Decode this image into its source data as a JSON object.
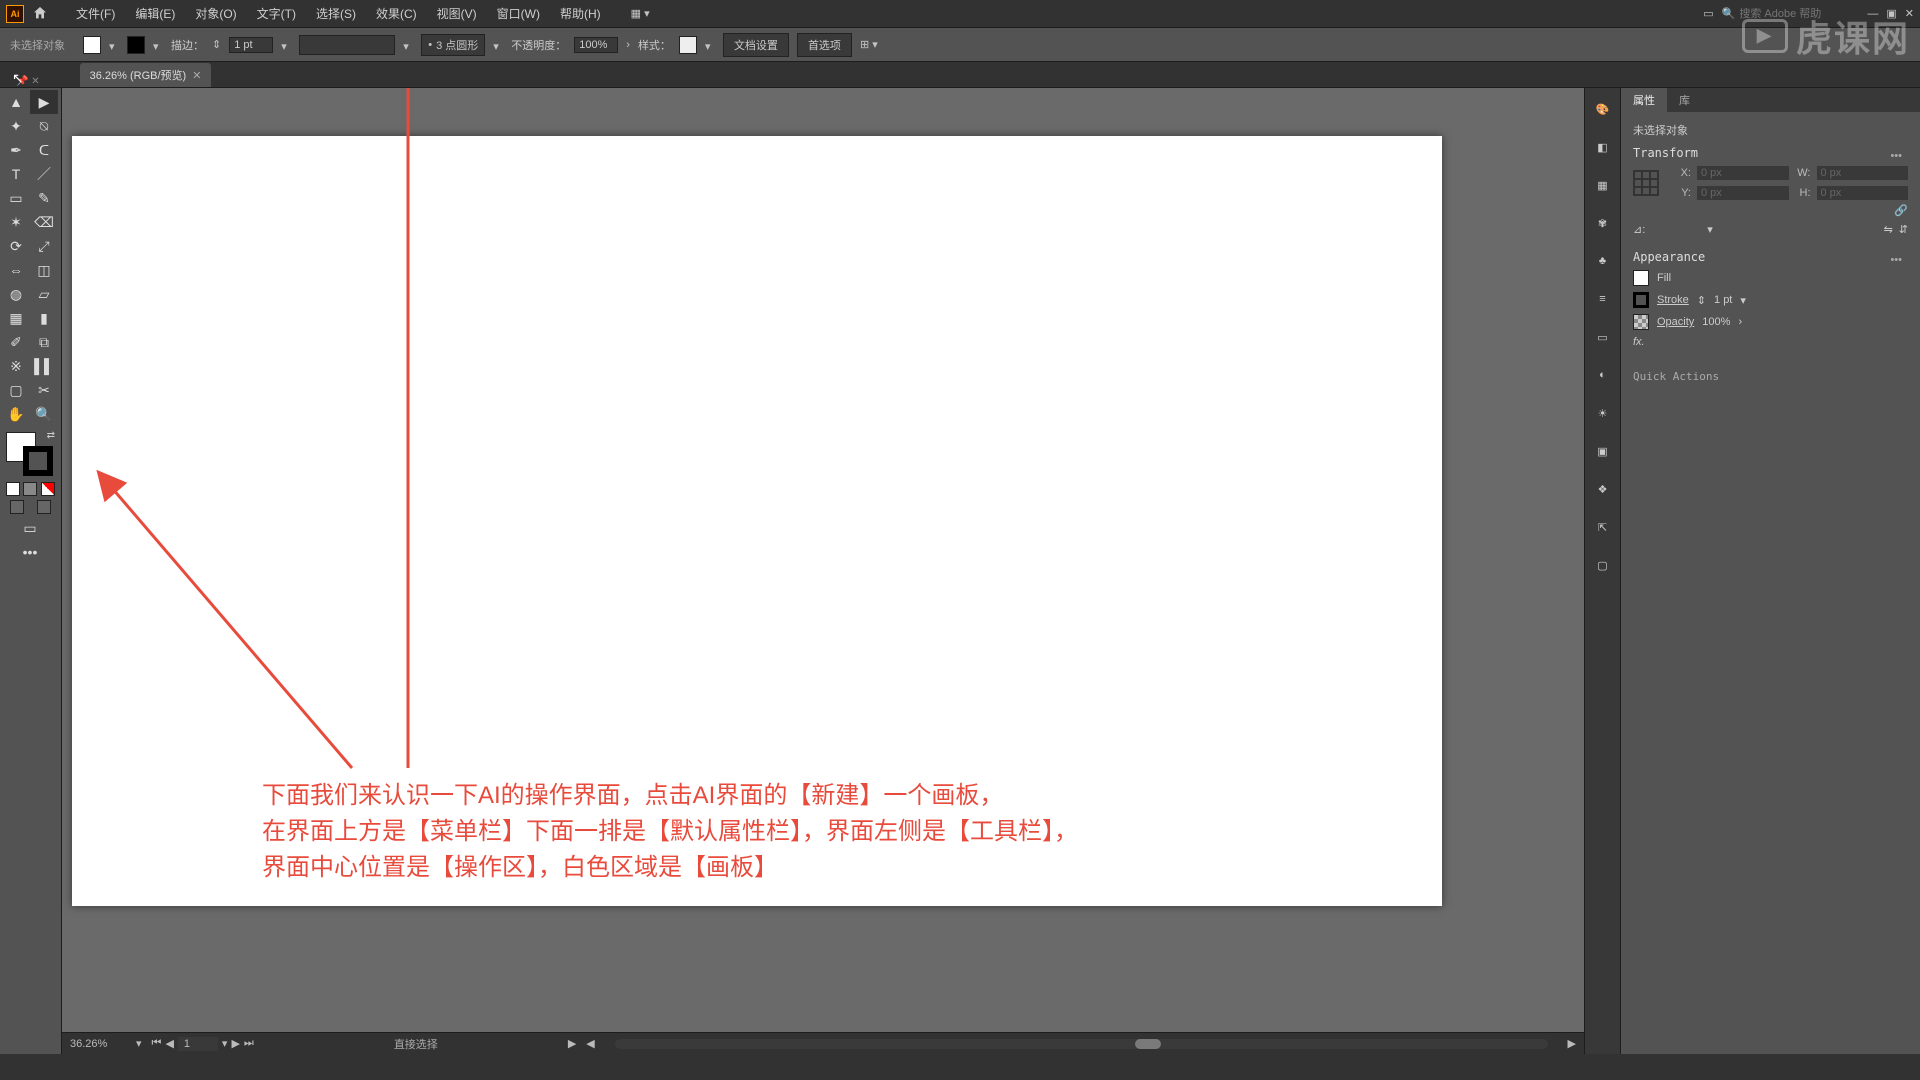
{
  "menubar": {
    "items": [
      "文件(F)",
      "编辑(E)",
      "对象(O)",
      "文字(T)",
      "选择(S)",
      "效果(C)",
      "视图(V)",
      "窗口(W)",
      "帮助(H)"
    ],
    "search_placeholder": "搜索 Adobe 帮助"
  },
  "control": {
    "no_selection": "未选择对象",
    "stroke_label": "描边：",
    "stroke_val": "1 pt",
    "dash_label": "3 点圆形",
    "opacity_label": "不透明度：",
    "opacity_val": "100%",
    "style_label": "样式：",
    "doc_setup": "文档设置",
    "prefs": "首选项"
  },
  "tab": {
    "label": "36.26% (RGB/预览)"
  },
  "status": {
    "zoom": "36.26%",
    "artboard": "1",
    "tool": "直接选择"
  },
  "properties": {
    "tabs": [
      "属性",
      "库"
    ],
    "no_selection": "未选择对象",
    "transform_title": "Transform",
    "x_label": "X:",
    "y_label": "Y:",
    "w_label": "W:",
    "h_label": "H:",
    "x_val": "0 px",
    "y_val": "0 px",
    "w_val": "0 px",
    "h_val": "0 px",
    "angle_label": "⊿:",
    "appearance_title": "Appearance",
    "fill_label": "Fill",
    "stroke_label": "Stroke",
    "stroke_val": "1 pt",
    "opacity_label": "Opacity",
    "opacity_val": "100%",
    "fx_label": "fx.",
    "quick_actions": "Quick Actions"
  },
  "annotation": {
    "line1": "下面我们来认识一下AI的操作界面，点击AI界面的【新建】一个画板，",
    "line2": "在界面上方是【菜单栏】下面一排是【默认属性栏】，界面左侧是【工具栏】，",
    "line3": "界面中心位置是【操作区】，白色区域是【画板】"
  },
  "watermark": "虎课网",
  "tool_names": [
    "selection-tool",
    "direct-selection-tool",
    "magic-wand-tool",
    "lasso-tool",
    "pen-tool",
    "curvature-tool",
    "type-tool",
    "line-tool",
    "rectangle-tool",
    "paintbrush-tool",
    "shaper-tool",
    "eraser-tool",
    "rotate-tool",
    "scale-tool",
    "width-tool",
    "free-transform-tool",
    "shape-builder-tool",
    "perspective-tool",
    "mesh-tool",
    "gradient-tool",
    "eyedropper-tool",
    "blend-tool",
    "symbol-sprayer-tool",
    "column-graph-tool",
    "artboard-tool",
    "slice-tool",
    "hand-tool",
    "zoom-tool"
  ]
}
